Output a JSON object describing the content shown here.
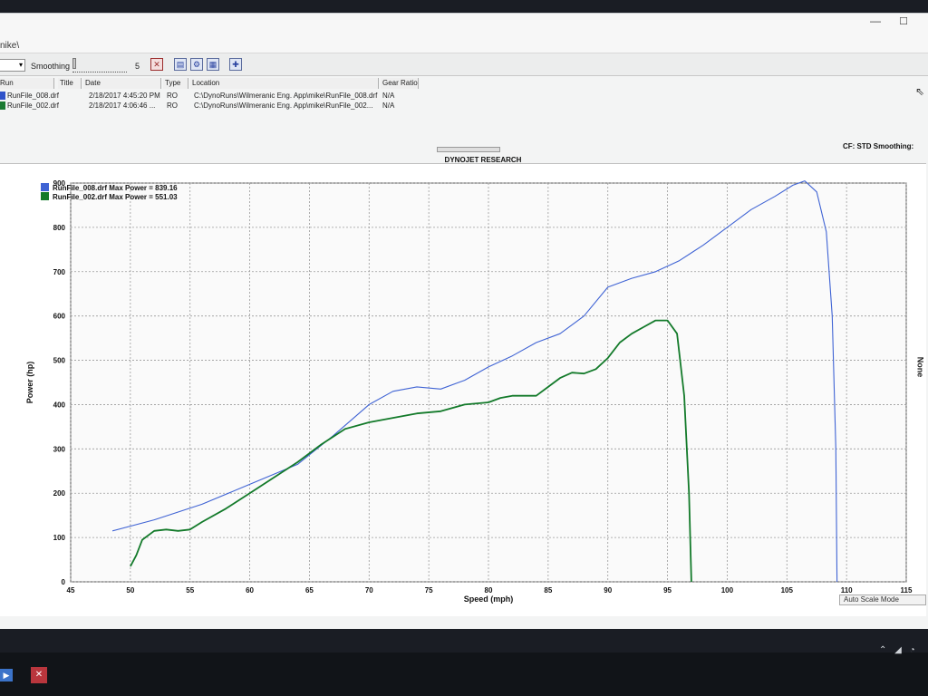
{
  "window": {
    "title_fragment": "nike\\",
    "min_glyph": "—",
    "max_glyph": "☐"
  },
  "toolbar": {
    "dropdown_arrow": "▾",
    "smoothing_label": "Smoothing",
    "smoothing_value": "5",
    "buttons": [
      "dyno-tool-icon",
      "compare-icon",
      "gear-icon",
      "grid-icon",
      "crosshair-icon"
    ]
  },
  "run_table": {
    "headers": [
      "Run",
      "Title",
      "Date",
      "Type",
      "Location",
      "Gear Ratio"
    ],
    "rows": [
      {
        "file": "RunFile_008.drf",
        "date": "2/18/2017 4:45:20 PM",
        "type": "RO",
        "location": "C:\\DynoRuns\\Wilmeranic Eng. App\\mike\\RunFile_008.drf",
        "gear": "N/A",
        "color": "#2f52c9"
      },
      {
        "file": "RunFile_002.drf",
        "date": "2/18/2017 4:06:46 ...",
        "type": "RO",
        "location": "C:\\DynoRuns\\Wilmeranic Eng. App\\mike\\RunFile_002...",
        "gear": "N/A",
        "color": "#1a7a32"
      }
    ]
  },
  "chart_header": {
    "title": "DYNOJET RESEARCH",
    "cf": "CF: STD  Smoothing:",
    "right_label": "None",
    "autoscale": "Auto Scale Mode"
  },
  "chart_data": {
    "type": "line",
    "title": "DYNOJET RESEARCH",
    "xlabel": "Speed (mph)",
    "ylabel": "Power (hp)",
    "xlim": [
      45,
      115
    ],
    "ylim": [
      0,
      900
    ],
    "x_ticks": [
      45,
      50,
      55,
      60,
      65,
      70,
      75,
      80,
      85,
      90,
      95,
      100,
      105,
      110,
      115
    ],
    "y_ticks": [
      0,
      100,
      200,
      300,
      400,
      500,
      600,
      700,
      800,
      900
    ],
    "grid": true,
    "legend_position": "top-left",
    "series": [
      {
        "name": "RunFile_008.drf Max Power = 839.16",
        "color": "#3f63d4",
        "points": [
          [
            48.5,
            115
          ],
          [
            52,
            140
          ],
          [
            56,
            175
          ],
          [
            60,
            220
          ],
          [
            64,
            265
          ],
          [
            67,
            330
          ],
          [
            70,
            400
          ],
          [
            72,
            430
          ],
          [
            74,
            440
          ],
          [
            76,
            435
          ],
          [
            78,
            455
          ],
          [
            80,
            485
          ],
          [
            82,
            510
          ],
          [
            84,
            540
          ],
          [
            86,
            560
          ],
          [
            88,
            600
          ],
          [
            90,
            665
          ],
          [
            92,
            685
          ],
          [
            94,
            700
          ],
          [
            96,
            725
          ],
          [
            98,
            760
          ],
          [
            100,
            800
          ],
          [
            102,
            840
          ],
          [
            104,
            870
          ],
          [
            105.5,
            895
          ],
          [
            106.5,
            905
          ],
          [
            107.5,
            880
          ],
          [
            108.3,
            790
          ],
          [
            108.8,
            600
          ],
          [
            109.1,
            300
          ],
          [
            109.2,
            0
          ]
        ]
      },
      {
        "name": "RunFile_002.drf Max Power = 551.03",
        "color": "#137a2a",
        "points": [
          [
            50,
            35
          ],
          [
            50.5,
            60
          ],
          [
            51,
            95
          ],
          [
            52,
            115
          ],
          [
            53,
            118
          ],
          [
            54,
            115
          ],
          [
            55,
            118
          ],
          [
            56,
            135
          ],
          [
            58,
            165
          ],
          [
            60,
            200
          ],
          [
            62,
            235
          ],
          [
            64,
            270
          ],
          [
            66,
            310
          ],
          [
            68,
            345
          ],
          [
            70,
            360
          ],
          [
            72,
            370
          ],
          [
            74,
            380
          ],
          [
            76,
            385
          ],
          [
            78,
            400
          ],
          [
            80,
            405
          ],
          [
            81,
            415
          ],
          [
            82,
            420
          ],
          [
            84,
            420
          ],
          [
            85,
            440
          ],
          [
            86,
            460
          ],
          [
            87,
            472
          ],
          [
            88,
            470
          ],
          [
            89,
            480
          ],
          [
            90,
            505
          ],
          [
            91,
            540
          ],
          [
            92,
            560
          ],
          [
            93,
            575
          ],
          [
            94,
            590
          ],
          [
            95,
            590
          ],
          [
            95.8,
            560
          ],
          [
            96.4,
            420
          ],
          [
            96.8,
            200
          ],
          [
            97,
            0
          ]
        ]
      }
    ]
  }
}
